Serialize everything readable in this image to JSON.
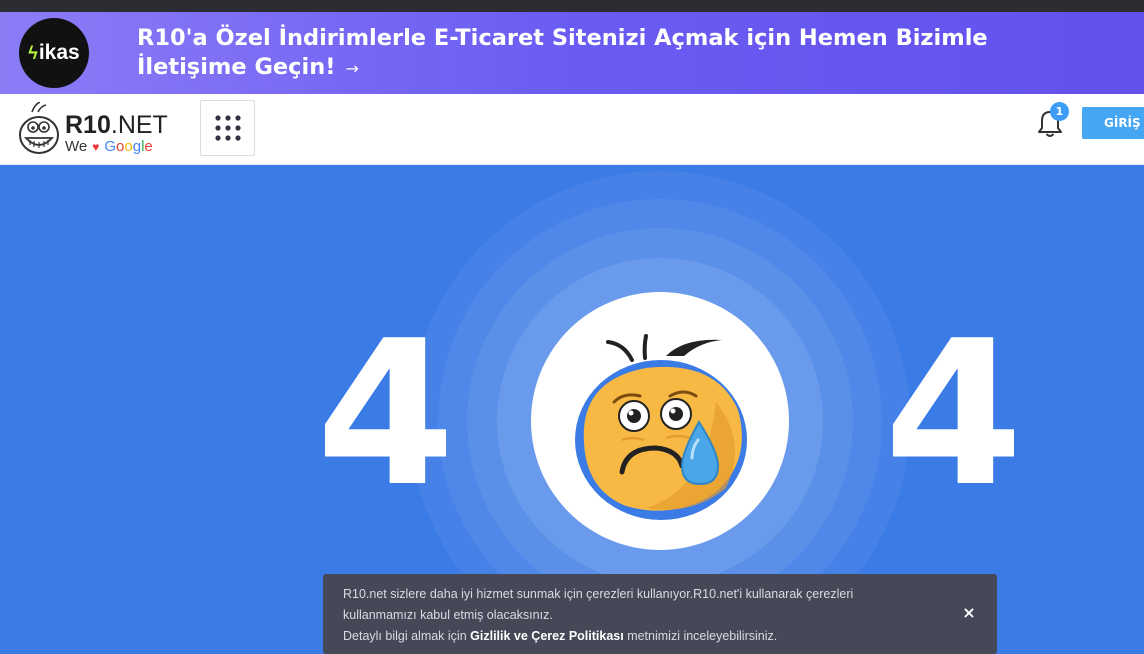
{
  "banner": {
    "logo_text": "ikas",
    "text": "R10'a Özel İndirimlerle E-Ticaret Sitenizi Açmak için Hemen Bizimle İletişime Geçin!",
    "arrow": "→"
  },
  "header": {
    "logo": {
      "name_bold": "R10",
      "name_rest": ".NET",
      "sub_we": "We",
      "sub_heart": "♥",
      "sub_google": "Google"
    },
    "apps_icon": "grid-dots-icon",
    "notification_count": "1",
    "login_label": "GİRİŞ Y"
  },
  "hero": {
    "digit_left": "4",
    "digit_right": "4"
  },
  "cookie": {
    "line1": "R10.net sizlere daha iyi hizmet sunmak için çerezleri kullanıyor.R10.net'i kullanarak çerezleri",
    "line2": "kullanmamızı kabul etmiş olacaksınız.",
    "line3_prefix": "Detaylı bilgi almak için",
    "link": "Gizlilik ve Çerez Politikası",
    "line3_suffix": "metnimizi inceleyebilirsiniz.",
    "close": "×"
  },
  "colors": {
    "hero_bg": "#3b7be6",
    "banner_start": "#8b7cf6",
    "banner_end": "#6351ee",
    "login_bg": "#45a6f4",
    "cookie_bg": "#454957"
  }
}
